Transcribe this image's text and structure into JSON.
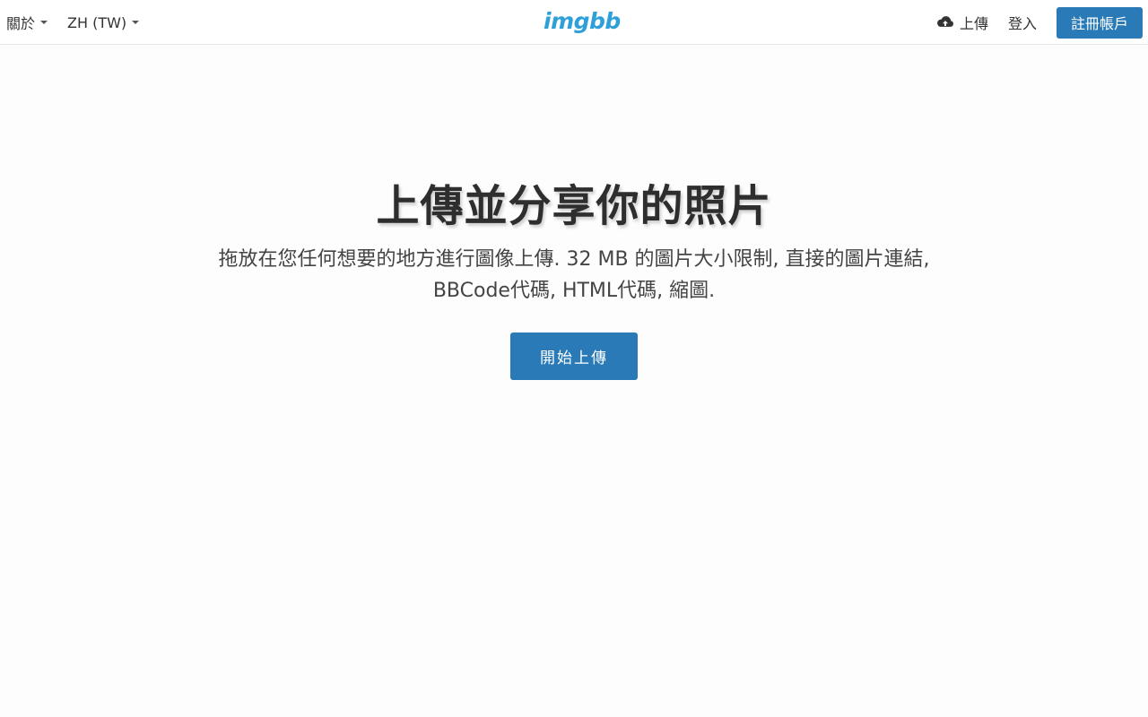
{
  "colors": {
    "brand": "#2a7ab7",
    "logo": "#2d9fd9",
    "text": "#333333"
  },
  "header": {
    "about_label": "關於",
    "language_label": "ZH (TW)",
    "logo_text": "imgbb",
    "upload_label": "上傳",
    "login_label": "登入",
    "signup_label": "註冊帳戶"
  },
  "icons": {
    "upload": "cloud-upload-icon",
    "dropdown": "caret-down-icon"
  },
  "hero": {
    "title": "上傳並分享你的照片",
    "description": "拖放在您任何想要的地方進行圖像上傳. 32 MB 的圖片大小限制, 直接的圖片連結, BBCode代碼, HTML代碼, 縮圖.",
    "start_button": "開始上傳"
  }
}
